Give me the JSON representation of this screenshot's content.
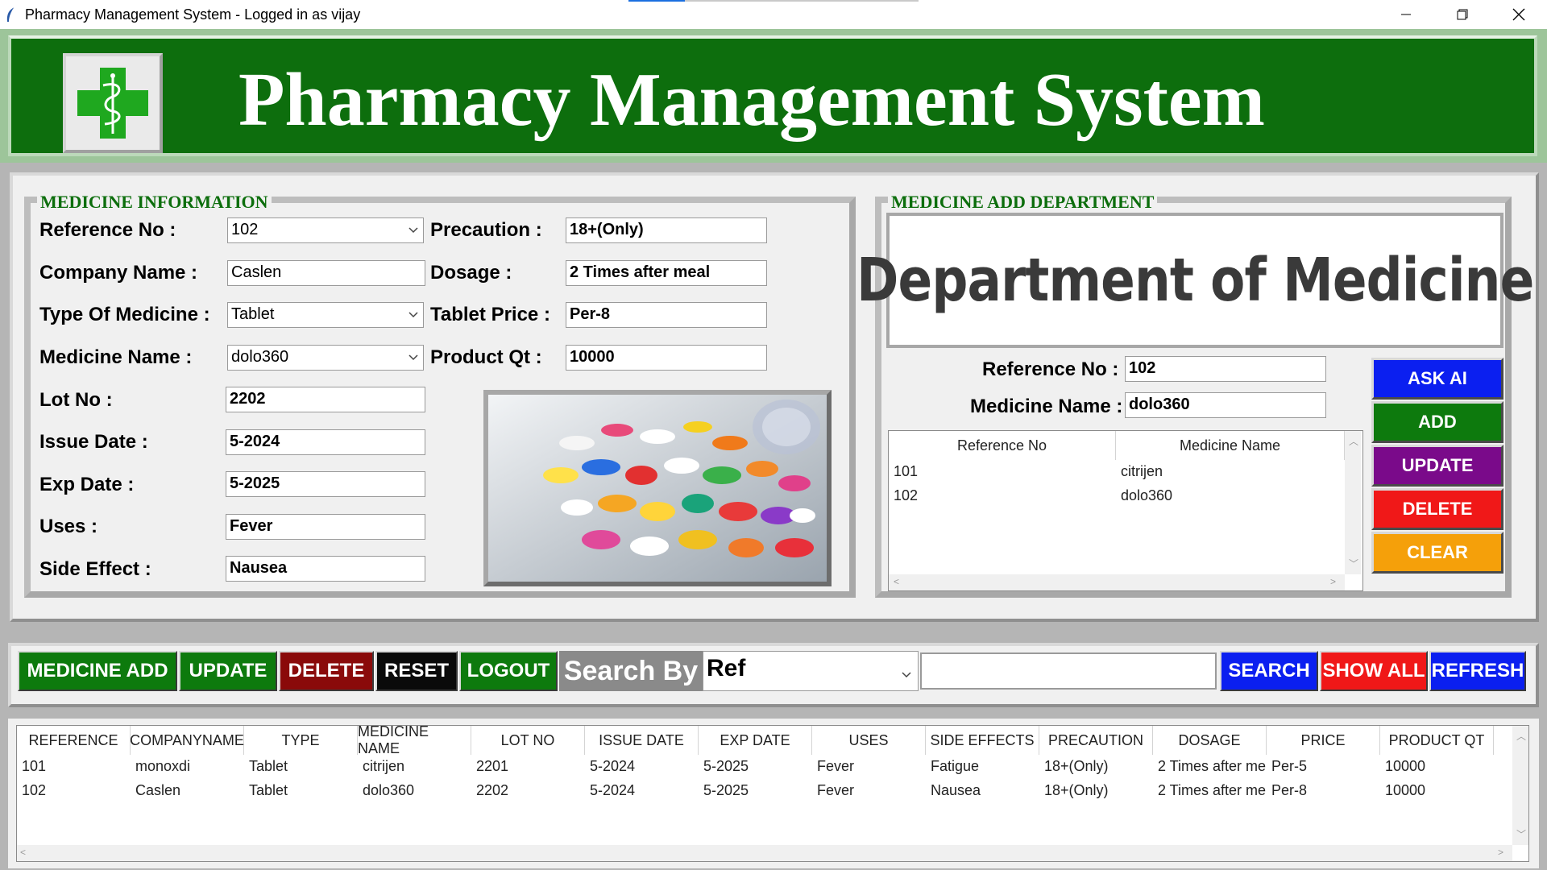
{
  "window": {
    "title": "Pharmacy Management System - Logged in as vijay",
    "minimize": "—",
    "restore": "❐",
    "close": "✕"
  },
  "header": {
    "title": "Pharmacy Management System",
    "logo_icon": "medical-cross-caduceus-icon"
  },
  "colors": {
    "header_green": "#0d6e0d",
    "legend_green": "#0d6e0d",
    "blue": "#0b1ff0",
    "green": "#0d7a0d",
    "purple": "#7a0a8a",
    "red": "#f01818",
    "orange": "#f5a00a",
    "dark_red": "#8a0a0a",
    "black": "#0a0a0a"
  },
  "medicine_info": {
    "legend": "MEDICINE INFORMATION",
    "reference_label": "Reference No :",
    "reference_value": "102",
    "company_label": "Company Name :",
    "company_value": "Caslen",
    "type_label": "Type Of Medicine :",
    "type_value": "Tablet",
    "medname_label": "Medicine Name :",
    "medname_value": "dolo360",
    "lot_label": "Lot No :",
    "lot_value": "2202",
    "issue_label": "Issue Date :",
    "issue_value": "5-2024",
    "exp_label": "Exp Date :",
    "exp_value": "5-2025",
    "uses_label": "Uses :",
    "uses_value": "Fever",
    "side_label": "Side Effect :",
    "side_value": "Nausea",
    "precaution_label": "Precaution :",
    "precaution_value": "18+(Only)",
    "dosage_label": "Dosage :",
    "dosage_value": "2 Times after meal",
    "price_label": "Tablet Price :",
    "price_value": "Per-8",
    "qty_label": "Product Qt :",
    "qty_value": "10000"
  },
  "medicine_add": {
    "legend": "MEDICINE ADD DEPARTMENT",
    "banner": "Department of Medicine",
    "reference_label": "Reference No :",
    "reference_value": "102",
    "medname_label": "Medicine Name :",
    "medname_value": "dolo360",
    "list_headers": [
      "Reference No",
      "Medicine Name"
    ],
    "list_rows": [
      [
        "101",
        "citrijen"
      ],
      [
        "102",
        "dolo360"
      ]
    ],
    "buttons": {
      "ask_ai": "ASK AI",
      "add": "ADD",
      "update": "UPDATE",
      "delete": "DELETE",
      "clear": "CLEAR"
    }
  },
  "toolbar": {
    "medicine_add": "MEDICINE ADD",
    "update": "UPDATE",
    "delete": "DELETE",
    "reset": "RESET",
    "logout": "LOGOUT",
    "search_by": "Search By",
    "search_field": "Ref",
    "search_value": "",
    "search": "SEARCH",
    "show_all": "SHOW ALL",
    "refresh": "REFRESH"
  },
  "table": {
    "headers": [
      "REFERENCE",
      "COMPANYNAME",
      "TYPE",
      "MEDICINE NAME",
      "LOT NO",
      "ISSUE DATE",
      "EXP DATE",
      "USES",
      "SIDE EFFECTS",
      "PRECAUTION",
      "DOSAGE",
      "PRICE",
      "PRODUCT QT"
    ],
    "rows": [
      [
        "101",
        "monoxdi",
        "Tablet",
        "citrijen",
        "2201",
        "5-2024",
        "5-2025",
        "Fever",
        "Fatigue",
        "18+(Only)",
        "2 Times after me",
        "Per-5",
        "10000"
      ],
      [
        "102",
        "Caslen",
        "Tablet",
        "dolo360",
        "2202",
        "5-2024",
        "5-2025",
        "Fever",
        "Nausea",
        "18+(Only)",
        "2 Times after me",
        "Per-8",
        "10000"
      ]
    ]
  }
}
